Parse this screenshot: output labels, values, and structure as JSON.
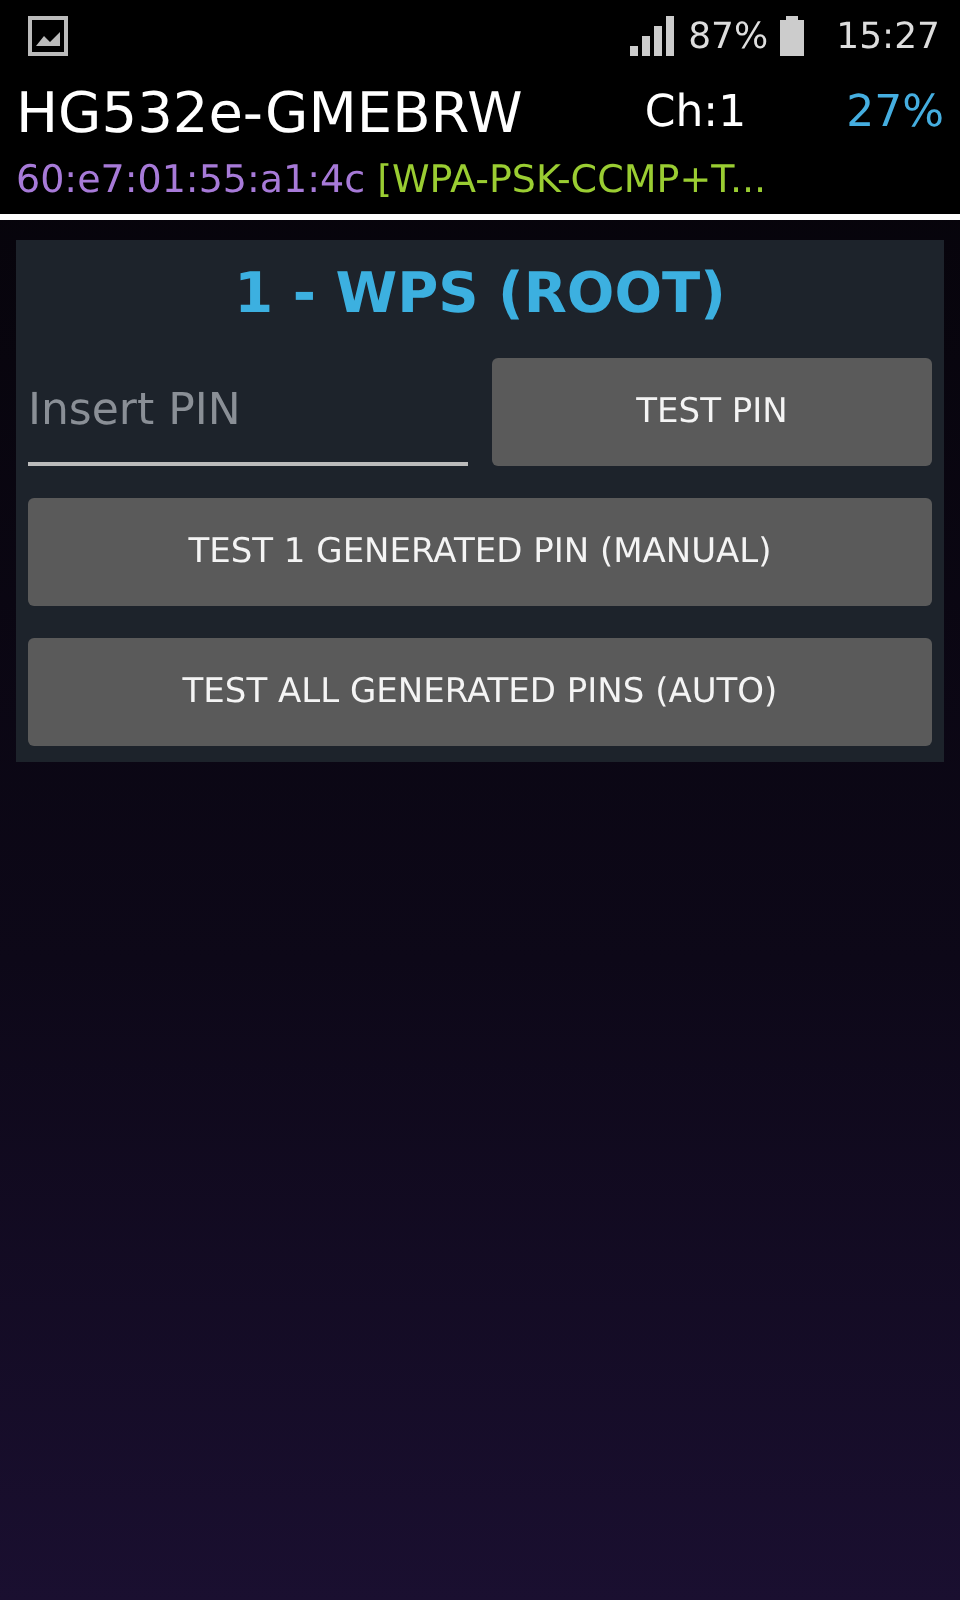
{
  "status_bar": {
    "battery": "87%",
    "time": "15:27"
  },
  "network": {
    "ssid": "HG532e-GMEBRW",
    "channel": "Ch:1",
    "signal": "27%",
    "bssid": "60:e7:01:55:a1:4c",
    "security": "[WPA-PSK-CCMP+T..."
  },
  "panel": {
    "title": "1 - WPS (ROOT)",
    "pin_field": {
      "placeholder": "Insert PIN"
    },
    "test_pin_button": "TEST PIN",
    "buttons": [
      "TEST 1 GENERATED PIN (MANUAL)",
      "TEST ALL GENERATED PINS (AUTO)"
    ]
  }
}
